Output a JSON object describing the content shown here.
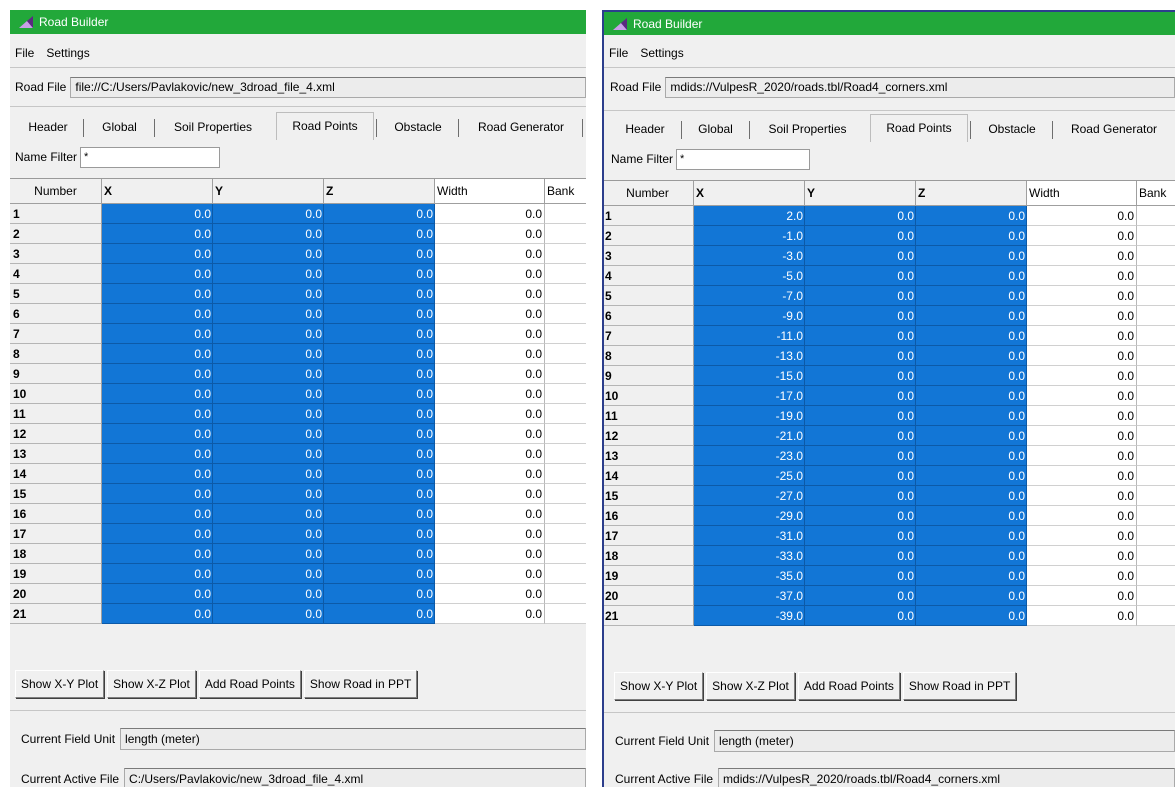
{
  "windows": [
    {
      "title": "Road Builder",
      "menu": [
        "File",
        "Settings"
      ],
      "road_file_label": "Road File",
      "road_file_value": "file://C:/Users/Pavlakovic/new_3droad_file_4.xml",
      "tabs": [
        "Header",
        "Global",
        "Soil Properties",
        "Road Points",
        "Obstacle",
        "Road Generator"
      ],
      "active_tab": "Road Points",
      "name_filter_label": "Name Filter",
      "name_filter_value": "*",
      "columns": [
        "Number",
        "X",
        "Y",
        "Z",
        "Width",
        "Bank"
      ],
      "rows": [
        [
          "1",
          "0.0",
          "0.0",
          "0.0",
          "0.0"
        ],
        [
          "2",
          "0.0",
          "0.0",
          "0.0",
          "0.0"
        ],
        [
          "3",
          "0.0",
          "0.0",
          "0.0",
          "0.0"
        ],
        [
          "4",
          "0.0",
          "0.0",
          "0.0",
          "0.0"
        ],
        [
          "5",
          "0.0",
          "0.0",
          "0.0",
          "0.0"
        ],
        [
          "6",
          "0.0",
          "0.0",
          "0.0",
          "0.0"
        ],
        [
          "7",
          "0.0",
          "0.0",
          "0.0",
          "0.0"
        ],
        [
          "8",
          "0.0",
          "0.0",
          "0.0",
          "0.0"
        ],
        [
          "9",
          "0.0",
          "0.0",
          "0.0",
          "0.0"
        ],
        [
          "10",
          "0.0",
          "0.0",
          "0.0",
          "0.0"
        ],
        [
          "11",
          "0.0",
          "0.0",
          "0.0",
          "0.0"
        ],
        [
          "12",
          "0.0",
          "0.0",
          "0.0",
          "0.0"
        ],
        [
          "13",
          "0.0",
          "0.0",
          "0.0",
          "0.0"
        ],
        [
          "14",
          "0.0",
          "0.0",
          "0.0",
          "0.0"
        ],
        [
          "15",
          "0.0",
          "0.0",
          "0.0",
          "0.0"
        ],
        [
          "16",
          "0.0",
          "0.0",
          "0.0",
          "0.0"
        ],
        [
          "17",
          "0.0",
          "0.0",
          "0.0",
          "0.0"
        ],
        [
          "18",
          "0.0",
          "0.0",
          "0.0",
          "0.0"
        ],
        [
          "19",
          "0.0",
          "0.0",
          "0.0",
          "0.0"
        ],
        [
          "20",
          "0.0",
          "0.0",
          "0.0",
          "0.0"
        ],
        [
          "21",
          "0.0",
          "0.0",
          "0.0",
          "0.0"
        ]
      ],
      "buttons": [
        "Show X-Y Plot",
        "Show X-Z Plot",
        "Add Road Points",
        "Show Road in PPT"
      ],
      "unit_label": "Current Field Unit",
      "unit_value": "length (meter)",
      "active_file_label": "Current Active File",
      "active_file_value": "C:/Users/Pavlakovic/new_3droad_file_4.xml"
    },
    {
      "title": "Road Builder",
      "menu": [
        "File",
        "Settings"
      ],
      "road_file_label": "Road File",
      "road_file_value": "mdids://VulpesR_2020/roads.tbl/Road4_corners.xml",
      "tabs": [
        "Header",
        "Global",
        "Soil Properties",
        "Road Points",
        "Obstacle",
        "Road Generator"
      ],
      "active_tab": "Road Points",
      "name_filter_label": "Name Filter",
      "name_filter_value": "*",
      "columns": [
        "Number",
        "X",
        "Y",
        "Z",
        "Width",
        "Bank"
      ],
      "rows": [
        [
          "1",
          "2.0",
          "0.0",
          "0.0",
          "0.0"
        ],
        [
          "2",
          "-1.0",
          "0.0",
          "0.0",
          "0.0"
        ],
        [
          "3",
          "-3.0",
          "0.0",
          "0.0",
          "0.0"
        ],
        [
          "4",
          "-5.0",
          "0.0",
          "0.0",
          "0.0"
        ],
        [
          "5",
          "-7.0",
          "0.0",
          "0.0",
          "0.0"
        ],
        [
          "6",
          "-9.0",
          "0.0",
          "0.0",
          "0.0"
        ],
        [
          "7",
          "-11.0",
          "0.0",
          "0.0",
          "0.0"
        ],
        [
          "8",
          "-13.0",
          "0.0",
          "0.0",
          "0.0"
        ],
        [
          "9",
          "-15.0",
          "0.0",
          "0.0",
          "0.0"
        ],
        [
          "10",
          "-17.0",
          "0.0",
          "0.0",
          "0.0"
        ],
        [
          "11",
          "-19.0",
          "0.0",
          "0.0",
          "0.0"
        ],
        [
          "12",
          "-21.0",
          "0.0",
          "0.0",
          "0.0"
        ],
        [
          "13",
          "-23.0",
          "0.0",
          "0.0",
          "0.0"
        ],
        [
          "14",
          "-25.0",
          "0.0",
          "0.0",
          "0.0"
        ],
        [
          "15",
          "-27.0",
          "0.0",
          "0.0",
          "0.0"
        ],
        [
          "16",
          "-29.0",
          "0.0",
          "0.0",
          "0.0"
        ],
        [
          "17",
          "-31.0",
          "0.0",
          "0.0",
          "0.0"
        ],
        [
          "18",
          "-33.0",
          "0.0",
          "0.0",
          "0.0"
        ],
        [
          "19",
          "-35.0",
          "0.0",
          "0.0",
          "0.0"
        ],
        [
          "20",
          "-37.0",
          "0.0",
          "0.0",
          "0.0"
        ],
        [
          "21",
          "-39.0",
          "0.0",
          "0.0",
          "0.0"
        ]
      ],
      "buttons": [
        "Show X-Y Plot",
        "Show X-Z Plot",
        "Add Road Points",
        "Show Road in PPT"
      ],
      "unit_label": "Current Field Unit",
      "unit_value": "length (meter)",
      "active_file_label": "Current Active File",
      "active_file_value": "mdids://VulpesR_2020/roads.tbl/Road4_corners.xml"
    }
  ],
  "colors": {
    "titlebar": "#22a83a",
    "selection": "#1276d6",
    "window_bg": "#f0f0f0"
  },
  "icons": {
    "app": "road-builder-app-icon"
  }
}
